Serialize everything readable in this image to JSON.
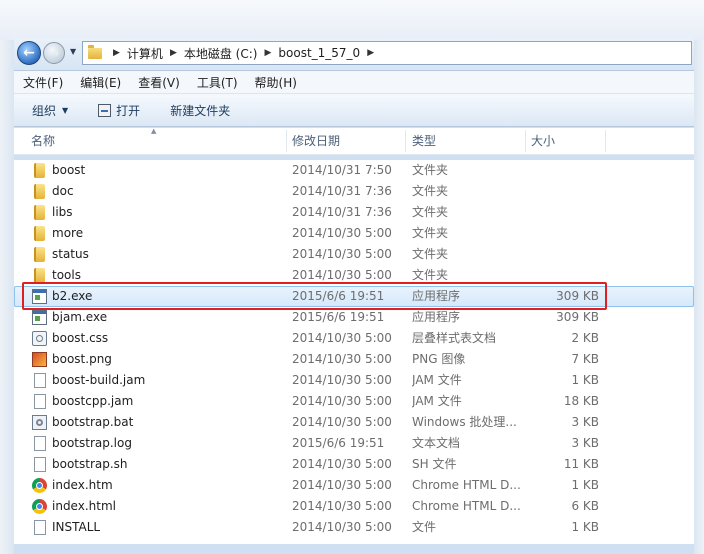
{
  "breadcrumbs": [
    "计算机",
    "本地磁盘 (C:)",
    "boost_1_57_0"
  ],
  "menu": [
    "文件(F)",
    "编辑(E)",
    "查看(V)",
    "工具(T)",
    "帮助(H)"
  ],
  "commands": {
    "organize": "组织",
    "open": "打开",
    "new_folder": "新建文件夹"
  },
  "columns": {
    "name": "名称",
    "date": "修改日期",
    "type": "类型",
    "size": "大小"
  },
  "files": [
    {
      "name": "boost",
      "date": "2014/10/31 7:50",
      "type": "文件夹",
      "size": "",
      "icon": "folder"
    },
    {
      "name": "doc",
      "date": "2014/10/31 7:36",
      "type": "文件夹",
      "size": "",
      "icon": "folder"
    },
    {
      "name": "libs",
      "date": "2014/10/31 7:36",
      "type": "文件夹",
      "size": "",
      "icon": "folder"
    },
    {
      "name": "more",
      "date": "2014/10/30 5:00",
      "type": "文件夹",
      "size": "",
      "icon": "folder"
    },
    {
      "name": "status",
      "date": "2014/10/30 5:00",
      "type": "文件夹",
      "size": "",
      "icon": "folder"
    },
    {
      "name": "tools",
      "date": "2014/10/30 5:00",
      "type": "文件夹",
      "size": "",
      "icon": "folder"
    },
    {
      "name": "b2.exe",
      "date": "2015/6/6 19:51",
      "type": "应用程序",
      "size": "309 KB",
      "icon": "exe",
      "selected": true
    },
    {
      "name": "bjam.exe",
      "date": "2015/6/6 19:51",
      "type": "应用程序",
      "size": "309 KB",
      "icon": "exe"
    },
    {
      "name": "boost.css",
      "date": "2014/10/30 5:00",
      "type": "层叠样式表文档",
      "size": "2 KB",
      "icon": "css"
    },
    {
      "name": "boost.png",
      "date": "2014/10/30 5:00",
      "type": "PNG 图像",
      "size": "7 KB",
      "icon": "png"
    },
    {
      "name": "boost-build.jam",
      "date": "2014/10/30 5:00",
      "type": "JAM 文件",
      "size": "1 KB",
      "icon": "doc"
    },
    {
      "name": "boostcpp.jam",
      "date": "2014/10/30 5:00",
      "type": "JAM 文件",
      "size": "18 KB",
      "icon": "doc"
    },
    {
      "name": "bootstrap.bat",
      "date": "2014/10/30 5:00",
      "type": "Windows 批处理...",
      "size": "3 KB",
      "icon": "bat"
    },
    {
      "name": "bootstrap.log",
      "date": "2015/6/6 19:51",
      "type": "文本文档",
      "size": "3 KB",
      "icon": "doc"
    },
    {
      "name": "bootstrap.sh",
      "date": "2014/10/30 5:00",
      "type": "SH 文件",
      "size": "11 KB",
      "icon": "doc"
    },
    {
      "name": "index.htm",
      "date": "2014/10/30 5:00",
      "type": "Chrome HTML D...",
      "size": "1 KB",
      "icon": "chrome"
    },
    {
      "name": "index.html",
      "date": "2014/10/30 5:00",
      "type": "Chrome HTML D...",
      "size": "6 KB",
      "icon": "chrome"
    },
    {
      "name": "INSTALL",
      "date": "2014/10/30 5:00",
      "type": "文件",
      "size": "1 KB",
      "icon": "doc"
    }
  ],
  "colors": {
    "selection_outline": "#e02020",
    "selected_row": "#d5e8fb"
  }
}
